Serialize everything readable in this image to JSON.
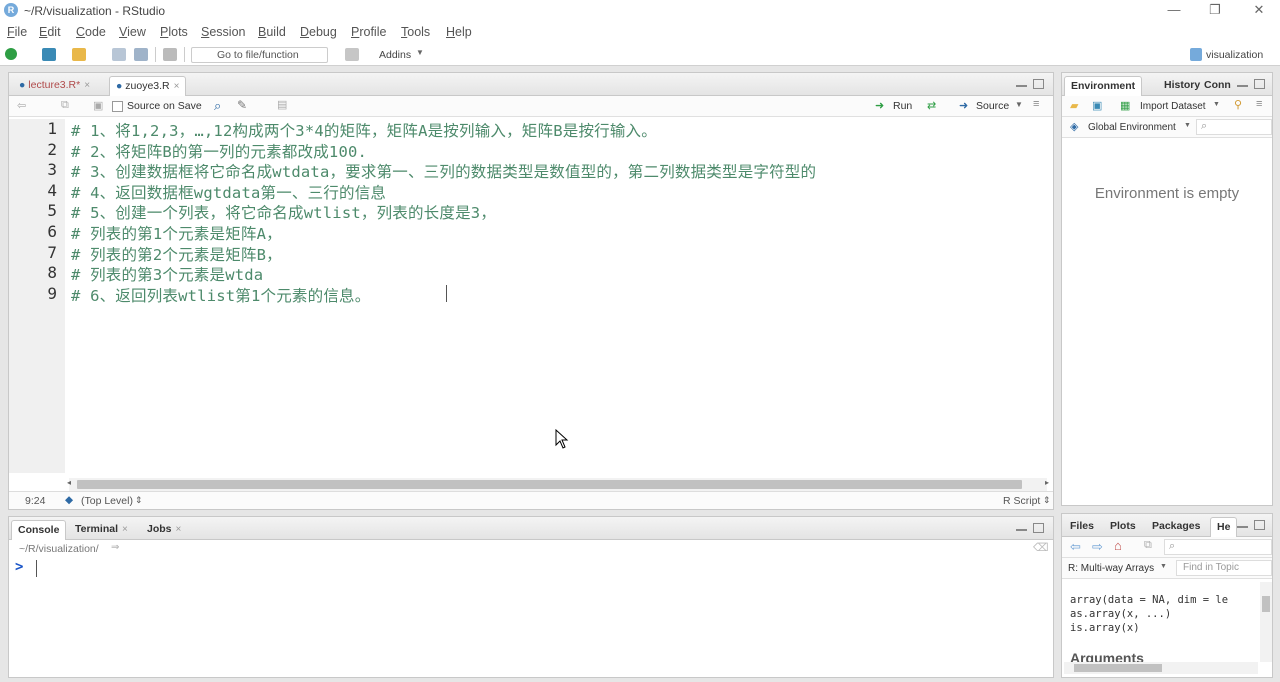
{
  "window": {
    "title": "~/R/visualization - RStudio",
    "logo_letter": "R",
    "minimize": "—",
    "restore": "❐",
    "close": "✕"
  },
  "menu": [
    "File",
    "Edit",
    "Code",
    "View",
    "Plots",
    "Session",
    "Build",
    "Debug",
    "Profile",
    "Tools",
    "Help"
  ],
  "toolbar": {
    "goto_placeholder": "Go to file/function",
    "addins_label": "Addins",
    "project_label": "visualization"
  },
  "editor": {
    "tabs": [
      {
        "label": "lecture3.R*",
        "active": false
      },
      {
        "label": "zuoye3.R",
        "active": true
      }
    ],
    "source_on_save": "Source on Save",
    "run_label": "Run",
    "source_label": "Source",
    "lines": [
      {
        "n": "1",
        "text": "# 1、将1,2,3，…,12构成两个3*4的矩阵，矩阵A是按列输入，矩阵B是按行输入。"
      },
      {
        "n": "2",
        "text": "# 2、将矩阵B的第一列的元素都改成100."
      },
      {
        "n": "3",
        "text": "# 3、创建数据框将它命名成wtdata，要求第一、三列的数据类型是数值型的，第二列数据类型是字符型的"
      },
      {
        "n": "4",
        "text": "# 4、返回数据框wgtdata第一、三行的信息"
      },
      {
        "n": "5",
        "text": "# 5、创建一个列表，将它命名成wtlist，列表的长度是3，"
      },
      {
        "n": "6",
        "text": "# 列表的第1个元素是矩阵A，"
      },
      {
        "n": "7",
        "text": "# 列表的第2个元素是矩阵B，"
      },
      {
        "n": "8",
        "text": "# 列表的第3个元素是wtda"
      },
      {
        "n": "9",
        "text": "# 6、返回列表wtlist第1个元素的信息。"
      }
    ],
    "status_pos": "9:24",
    "status_scope": "(Top Level)",
    "status_type": "R Script"
  },
  "console": {
    "tabs": [
      {
        "label": "Console",
        "active": true
      },
      {
        "label": "Terminal",
        "active": false
      },
      {
        "label": "Jobs",
        "active": false
      }
    ],
    "path": "~/R/visualization/",
    "prompt": ">"
  },
  "environment": {
    "tabs": [
      {
        "label": "Environment",
        "active": true
      },
      {
        "label": "History",
        "active": false
      },
      {
        "label": "Conn",
        "active": false
      }
    ],
    "import_label": "Import Dataset",
    "global_env": "Global Environment",
    "empty_msg": "Environment is empty"
  },
  "files": {
    "tabs": [
      {
        "label": "Files",
        "active": false
      },
      {
        "label": "Plots",
        "active": false
      },
      {
        "label": "Packages",
        "active": false
      },
      {
        "label": "He",
        "active": true
      }
    ],
    "topic": "R: Multi-way Arrays",
    "find_placeholder": "Find in Topic",
    "help_lines": [
      "array(data = NA, dim = le",
      "as.array(x, ...)",
      "is.array(x)"
    ],
    "section": "Arguments"
  },
  "colors": {
    "comment": "#4d8a6b",
    "accent": "#75aadb",
    "prompt": "#1a55c8"
  }
}
